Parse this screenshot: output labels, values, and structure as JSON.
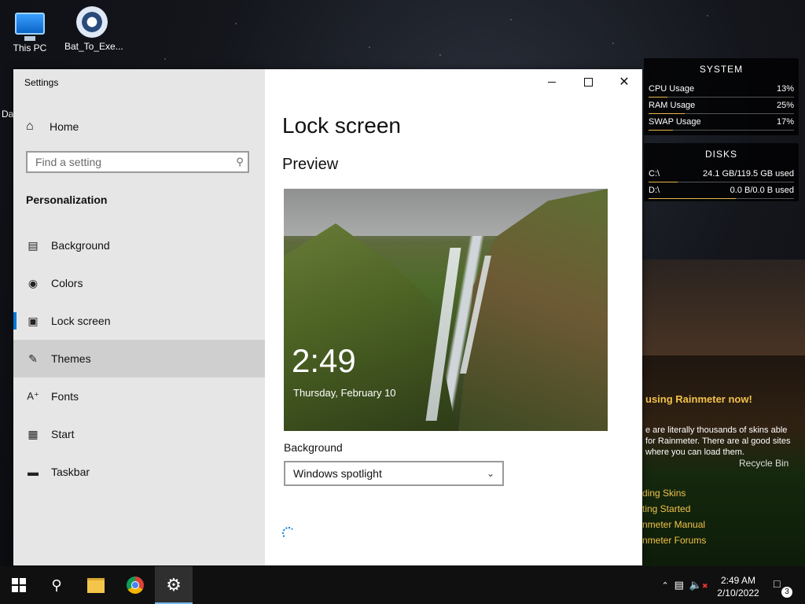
{
  "desktop": {
    "icons": [
      {
        "label": "This PC"
      },
      {
        "label": "Bat_To_Exe..."
      }
    ],
    "edge_text": "Da"
  },
  "window": {
    "app_title": "Settings",
    "home_label": "Home",
    "search_placeholder": "Find a setting",
    "section_heading": "Personalization",
    "nav_items": [
      {
        "label": "Background",
        "icon": "picture-icon"
      },
      {
        "label": "Colors",
        "icon": "palette-icon"
      },
      {
        "label": "Lock screen",
        "icon": "lock-screen-icon"
      },
      {
        "label": "Themes",
        "icon": "themes-icon"
      },
      {
        "label": "Fonts",
        "icon": "fonts-icon"
      },
      {
        "label": "Start",
        "icon": "start-icon"
      },
      {
        "label": "Taskbar",
        "icon": "taskbar-icon"
      }
    ],
    "page_title": "Lock screen",
    "preview_heading": "Preview",
    "preview_time": "2:49",
    "preview_date": "Thursday, February 10",
    "background_label": "Background",
    "background_value": "Windows spotlight"
  },
  "rainmeter": {
    "system": {
      "title": "SYSTEM",
      "rows": [
        {
          "label": "CPU Usage",
          "value": "13%",
          "fill": 0.13
        },
        {
          "label": "RAM Usage",
          "value": "25%",
          "fill": 0.25
        },
        {
          "label": "SWAP Usage",
          "value": "17%",
          "fill": 0.17
        }
      ]
    },
    "disks": {
      "title": "DISKS",
      "rows": [
        {
          "label": "C:\\",
          "value": "24.1 GB/119.5 GB used",
          "fill": 0.2
        },
        {
          "label": "D:\\",
          "value": "0.0 B/0.0 B used",
          "fill": 0.6
        }
      ]
    },
    "welcome": {
      "heading": "using Rainmeter now!",
      "body": "e are literally thousands of skins able for Rainmeter. There are al good sites where you can load them.",
      "links": [
        "ding Skins",
        "ting Started",
        "nmeter Manual",
        "nmeter Forums"
      ]
    },
    "recycle_bin": "Recycle Bin"
  },
  "taskbar": {
    "time": "2:49 AM",
    "date": "2/10/2022",
    "notification_count": "3"
  },
  "colors": {
    "accent": "#0078d7",
    "rainmeter_accent": "#e6b64b"
  }
}
